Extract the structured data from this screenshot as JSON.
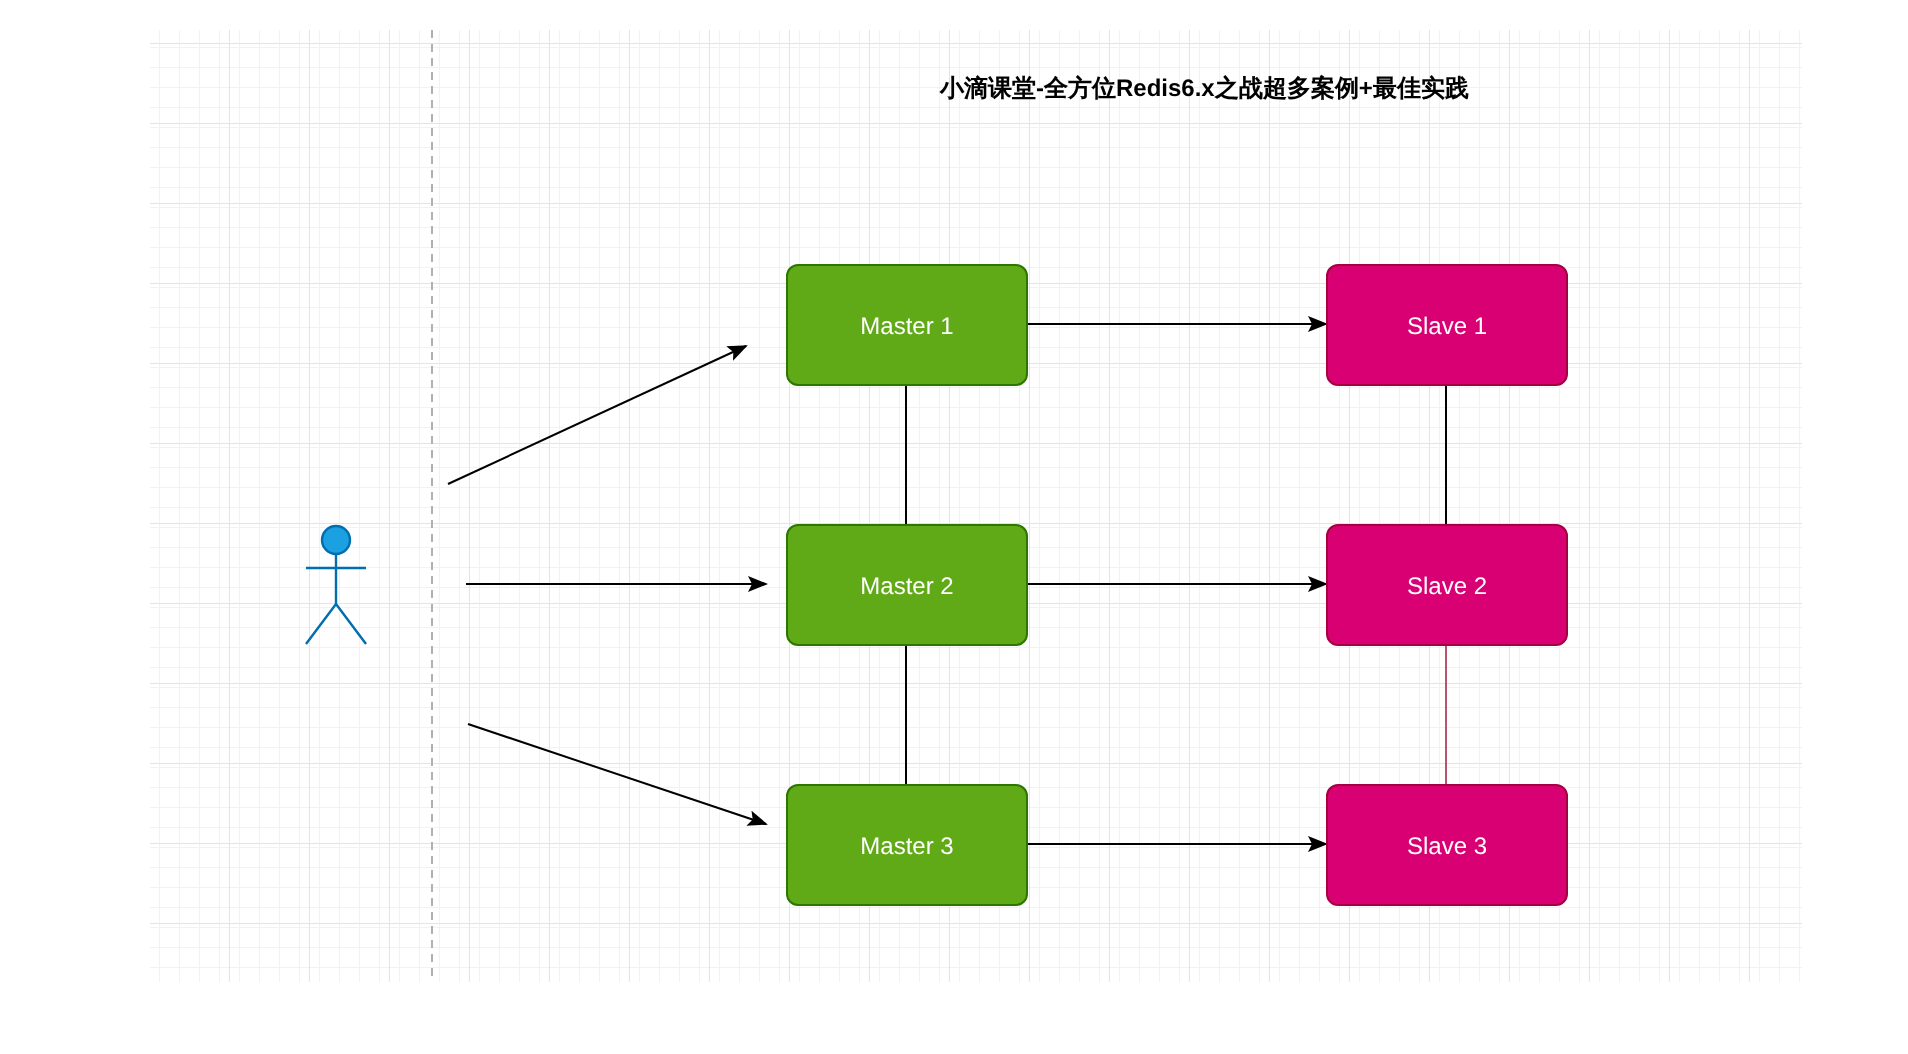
{
  "title": "小滴课堂-全方位Redis6.x之战超多案例+最佳实践",
  "nodes": [
    {
      "label": "Master 1",
      "kind": "master"
    },
    {
      "label": "Master 2",
      "kind": "master"
    },
    {
      "label": "Master 3",
      "kind": "master"
    },
    {
      "label": "Slave 1",
      "kind": "slave"
    },
    {
      "label": "Slave 2",
      "kind": "slave"
    },
    {
      "label": "Slave 3",
      "kind": "slave"
    }
  ]
}
